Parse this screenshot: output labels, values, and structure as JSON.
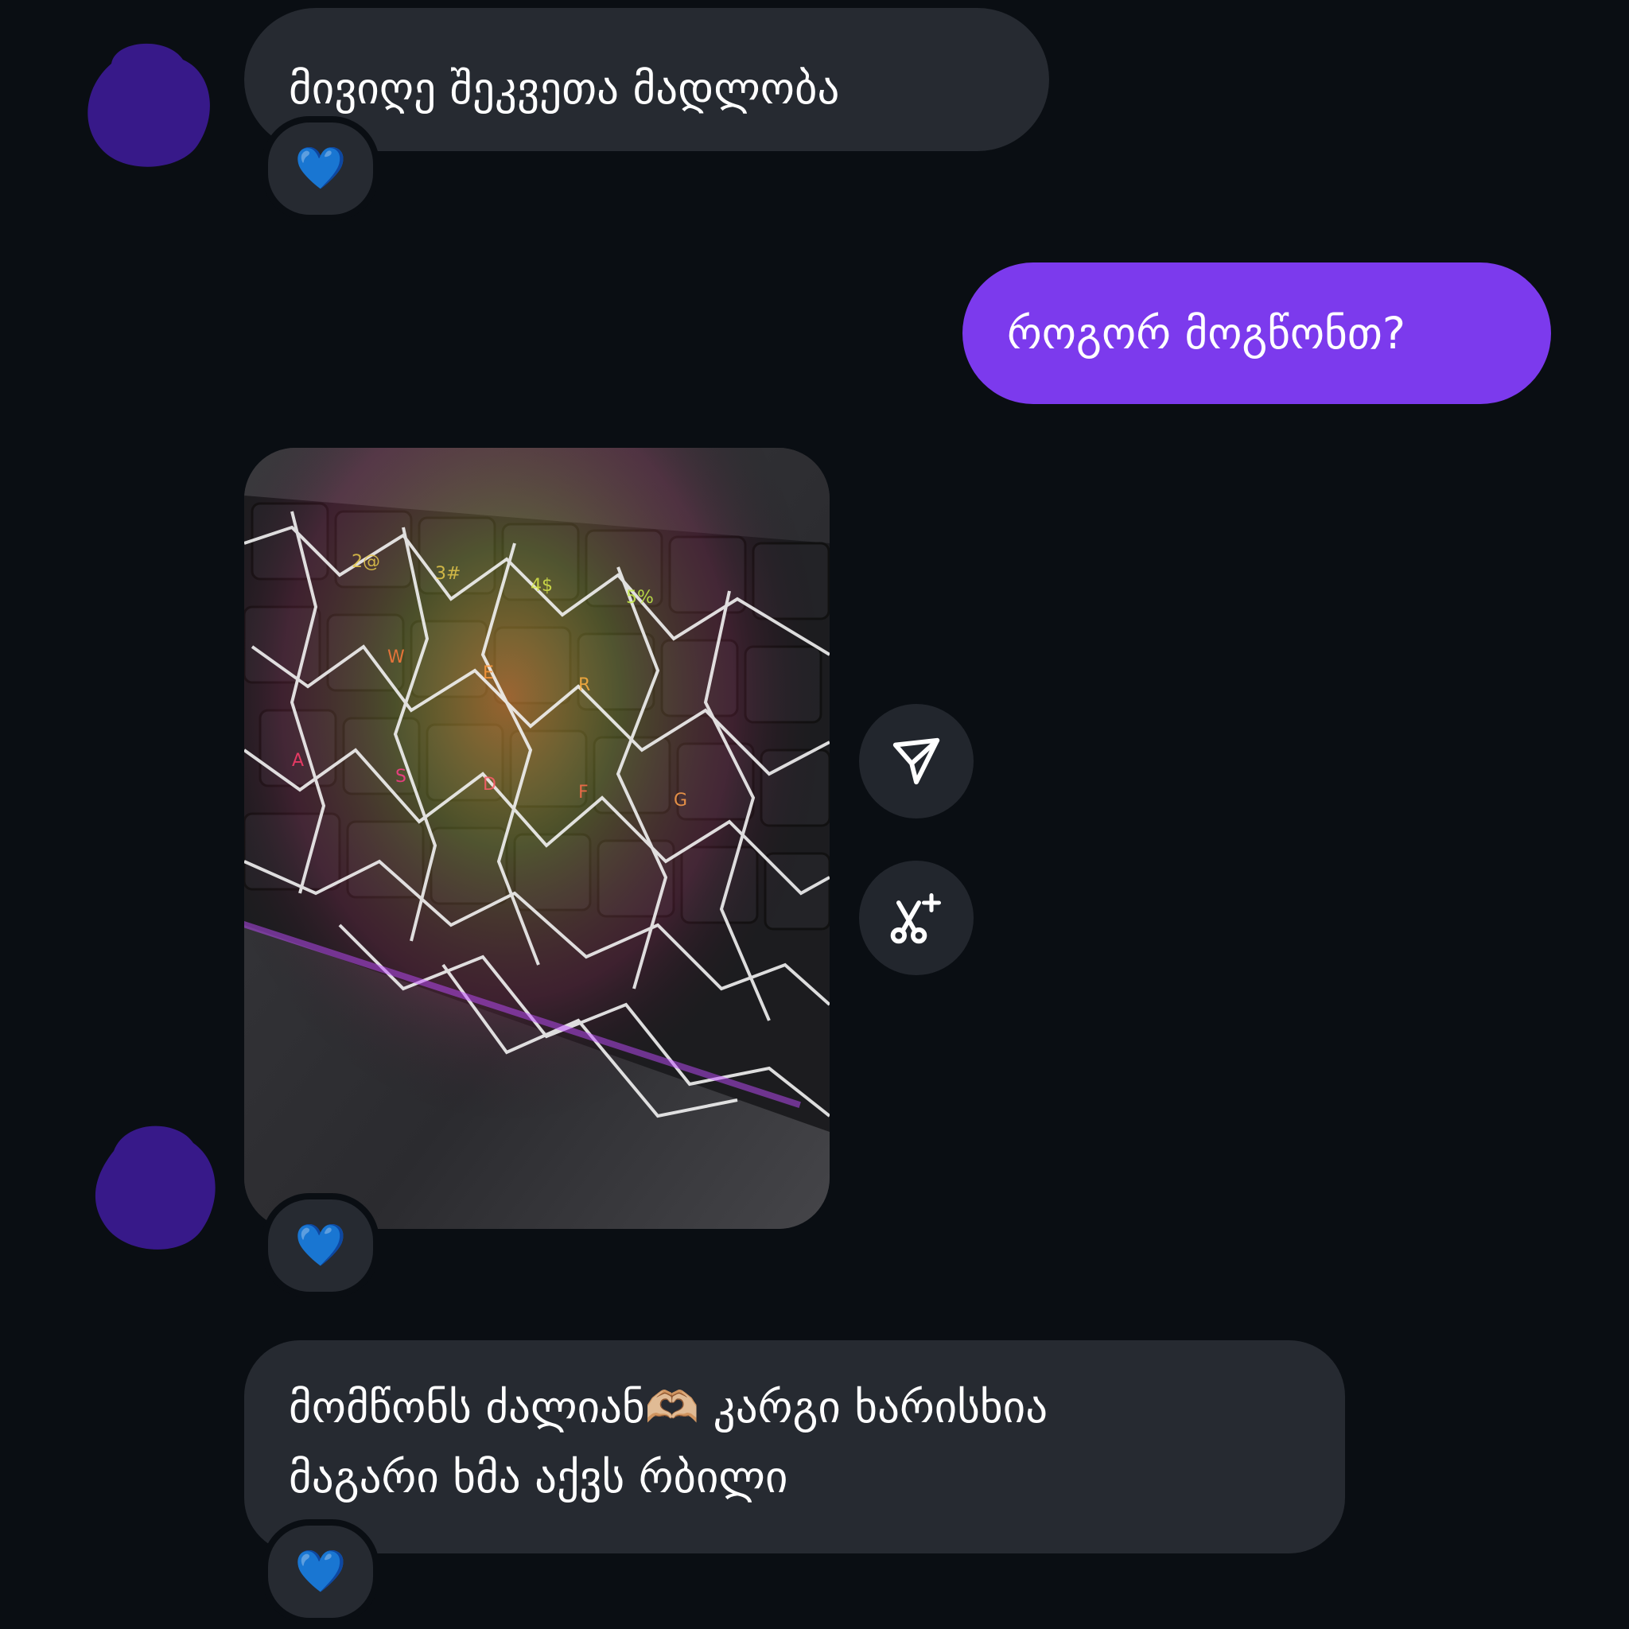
{
  "colors": {
    "background": "#0a0e13",
    "incoming_bubble": "#262a31",
    "outgoing_bubble": "#7c3aed",
    "avatar_blur": "#3a1a8f",
    "action_button": "#22262d"
  },
  "messages": [
    {
      "direction": "incoming",
      "text": "მივიღე შეკვეთა მადლობა",
      "reaction": "💙"
    },
    {
      "direction": "outgoing",
      "text": "როგორ მოგწონთ?"
    },
    {
      "direction": "incoming",
      "type": "image",
      "image_description_icon": "keyboard-photo",
      "reaction": "💙"
    },
    {
      "direction": "incoming",
      "lines": [
        "მომწონს ძალიან🫶🏼 კარგი ხარისხია",
        "მაგარი ხმა აქვს რბილი"
      ],
      "reaction": "💙"
    }
  ],
  "actions": {
    "share_icon": "send-icon",
    "edit_icon": "scissors-sparkle-icon"
  }
}
